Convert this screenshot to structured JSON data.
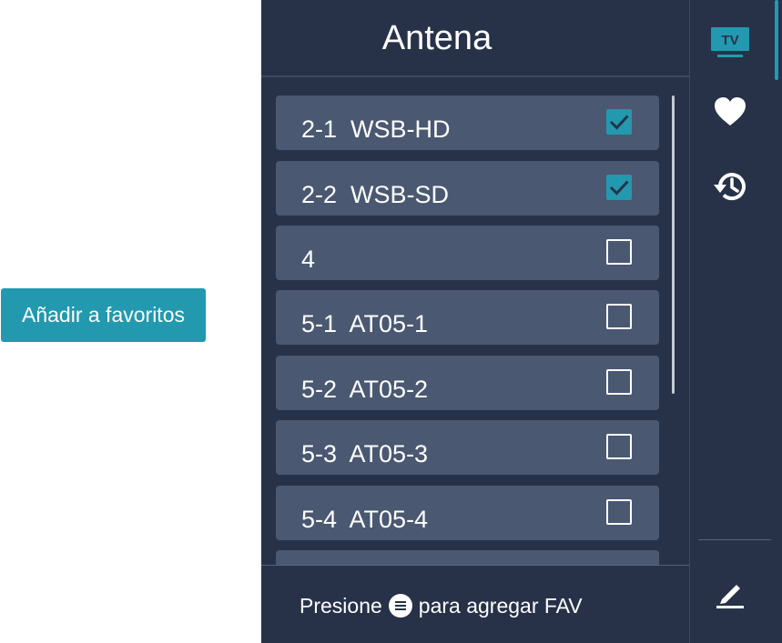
{
  "left": {
    "add_favorites_button": "Añadir a favoritos"
  },
  "panel": {
    "title": "Antena",
    "channels": [
      {
        "label": "2-1  WSB-HD",
        "checked": true
      },
      {
        "label": "2-2  WSB-SD",
        "checked": true
      },
      {
        "label": "4",
        "checked": false
      },
      {
        "label": "5-1  AT05-1",
        "checked": false
      },
      {
        "label": "5-2  AT05-2",
        "checked": false
      },
      {
        "label": "5-3  AT05-3",
        "checked": false
      },
      {
        "label": "5-4  AT05-4",
        "checked": false
      },
      {
        "label": "",
        "checked": false
      }
    ],
    "footer": {
      "hint_before": "Presione",
      "hint_icon": "menu-icon",
      "hint_after": "para agregar FAV"
    }
  },
  "sidebar": {
    "tv_badge": "TV",
    "items": [
      {
        "icon": "tv-icon",
        "selected": true
      },
      {
        "icon": "heart-icon",
        "selected": false
      },
      {
        "icon": "history-icon",
        "selected": false
      },
      {
        "icon": "edit-icon",
        "selected": false
      }
    ]
  },
  "colors": {
    "accent": "#2299ae",
    "panel_bg": "#273249",
    "row_bg": "#4a5871",
    "text": "#ffffff"
  }
}
